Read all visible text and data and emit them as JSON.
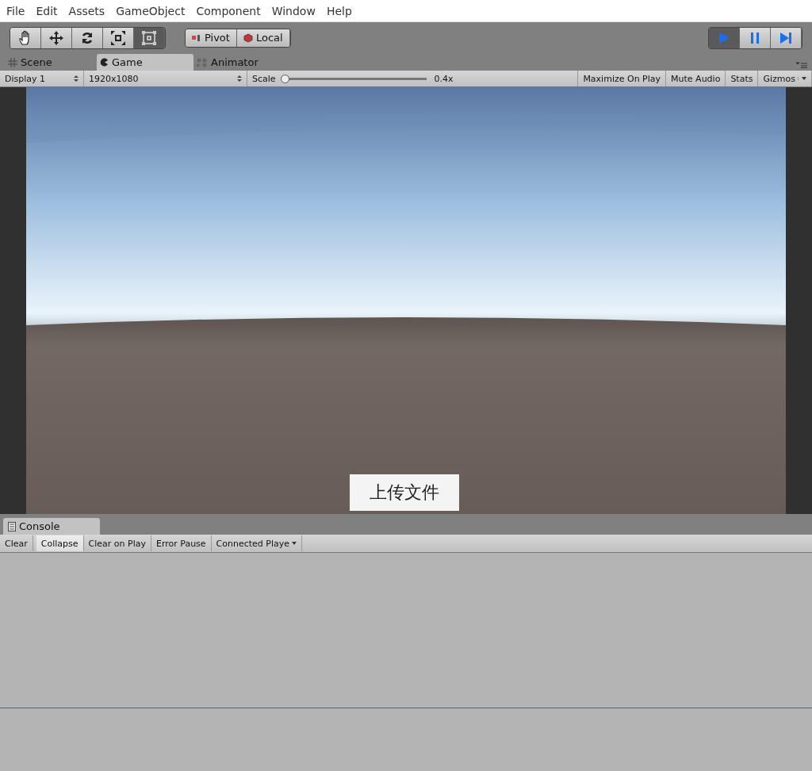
{
  "menu": [
    "File",
    "Edit",
    "Assets",
    "GameObject",
    "Component",
    "Window",
    "Help"
  ],
  "tools": [
    {
      "kind": "hand",
      "selected": false
    },
    {
      "kind": "move",
      "selected": false
    },
    {
      "kind": "rotate",
      "selected": false
    },
    {
      "kind": "scale",
      "selected": false
    },
    {
      "kind": "rect",
      "selected": true
    }
  ],
  "handles": [
    {
      "kind": "pivot",
      "label": "Pivot"
    },
    {
      "kind": "local",
      "label": "Local"
    }
  ],
  "playback": [
    {
      "kind": "play",
      "on": true
    },
    {
      "kind": "pause",
      "on": false
    },
    {
      "kind": "step",
      "on": false
    }
  ],
  "tabs": [
    {
      "kind": "scene",
      "label": "Scene",
      "selected": false
    },
    {
      "kind": "game",
      "label": "Game",
      "selected": true
    },
    {
      "kind": "animator",
      "label": "Animator",
      "selected": false
    }
  ],
  "game_toolbar": {
    "display": "Display 1",
    "resolution": "1920x1080",
    "scale_label": "Scale",
    "scale": {
      "level": 0.0
    },
    "scale_reading": "0.4x",
    "toggles": [
      {
        "label": "Maximize On Play",
        "on": false
      },
      {
        "label": "Mute Audio",
        "on": false
      },
      {
        "label": "Stats",
        "on": false
      }
    ],
    "gizmos": "Gizmos"
  },
  "game_view": {
    "kind": "picture",
    "button": "上传文件"
  },
  "console": {
    "tab": "Console",
    "buttons": [
      {
        "kind": "button",
        "label": "Clear"
      },
      {
        "kind": "toggle",
        "label": "Collapse",
        "on": true
      },
      {
        "kind": "toggle",
        "label": "Clear on Play",
        "on": false
      },
      {
        "kind": "toggle",
        "label": "Error Pause",
        "on": false
      },
      {
        "kind": "dropdown",
        "label": "Connected Playe"
      }
    ]
  }
}
